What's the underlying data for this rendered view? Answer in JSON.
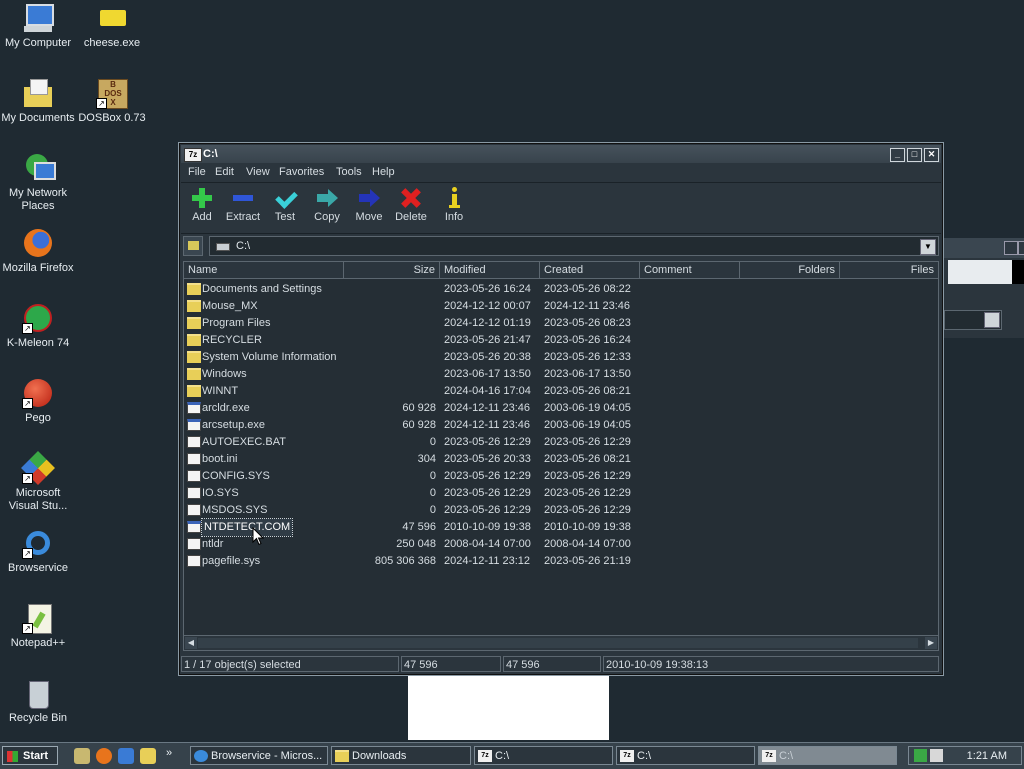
{
  "desktop": {
    "icons": [
      {
        "label": "My Computer"
      },
      {
        "label": "cheese.exe"
      },
      {
        "label": "My Documents"
      },
      {
        "label": "DOSBox 0.73",
        "badge": "B\nDOS"
      },
      {
        "label": "My Network Places"
      },
      {
        "label": "Mozilla Firefox"
      },
      {
        "label": "K-Meleon 74"
      },
      {
        "label": "Pego"
      },
      {
        "label": "Microsoft Visual Stu..."
      },
      {
        "label": "Browservice"
      },
      {
        "label": "Notepad++"
      },
      {
        "label": "Recycle Bin"
      }
    ]
  },
  "window": {
    "icon_text": "7z",
    "title": "C:\\",
    "controls": {
      "minimize": "_",
      "maximize": "□",
      "close": "✕"
    },
    "menu": [
      "File",
      "Edit",
      "View",
      "Favorites",
      "Tools",
      "Help"
    ],
    "toolbar": [
      {
        "label": "Add",
        "icon": "plus-icon",
        "color": "#34c84a"
      },
      {
        "label": "Extract",
        "icon": "minus-icon",
        "color": "#2f56d8"
      },
      {
        "label": "Test",
        "icon": "check-icon",
        "color": "#3ad0d8"
      },
      {
        "label": "Copy",
        "icon": "copy-arrow-icon",
        "color": "#3aa8a8"
      },
      {
        "label": "Move",
        "icon": "move-arrow-icon",
        "color": "#2434b8"
      },
      {
        "label": "Delete",
        "icon": "delete-x-icon",
        "color": "#e02020"
      },
      {
        "label": "Info",
        "icon": "info-icon",
        "color": "#e8d020"
      }
    ],
    "address": {
      "path": "C:\\",
      "dropdown": "▼"
    },
    "columns": [
      "Name",
      "Size",
      "Modified",
      "Created",
      "Comment",
      "Folders",
      "Files"
    ],
    "files": [
      {
        "name": "Documents and Settings",
        "size": "",
        "modified": "2023-05-26 16:24",
        "created": "2023-05-26 08:22",
        "kind": "folder"
      },
      {
        "name": "Mouse_MX",
        "size": "",
        "modified": "2024-12-12 00:07",
        "created": "2024-12-11 23:46",
        "kind": "folder"
      },
      {
        "name": "Program Files",
        "size": "",
        "modified": "2024-12-12 01:19",
        "created": "2023-05-26 08:23",
        "kind": "folder"
      },
      {
        "name": "RECYCLER",
        "size": "",
        "modified": "2023-05-26 21:47",
        "created": "2023-05-26 16:24",
        "kind": "folder"
      },
      {
        "name": "System Volume Information",
        "size": "",
        "modified": "2023-05-26 20:38",
        "created": "2023-05-26 12:33",
        "kind": "folder"
      },
      {
        "name": "Windows",
        "size": "",
        "modified": "2023-06-17 13:50",
        "created": "2023-06-17 13:50",
        "kind": "folder"
      },
      {
        "name": "WINNT",
        "size": "",
        "modified": "2024-04-16 17:04",
        "created": "2023-05-26 08:21",
        "kind": "folder"
      },
      {
        "name": "arcldr.exe",
        "size": "60 928",
        "modified": "2024-12-11 23:46",
        "created": "2003-06-19 04:05",
        "kind": "exe"
      },
      {
        "name": "arcsetup.exe",
        "size": "60 928",
        "modified": "2024-12-11 23:46",
        "created": "2003-06-19 04:05",
        "kind": "exe"
      },
      {
        "name": "AUTOEXEC.BAT",
        "size": "0",
        "modified": "2023-05-26 12:29",
        "created": "2023-05-26 12:29",
        "kind": "bat"
      },
      {
        "name": "boot.ini",
        "size": "304",
        "modified": "2023-05-26 20:33",
        "created": "2023-05-26 08:21",
        "kind": "file"
      },
      {
        "name": "CONFIG.SYS",
        "size": "0",
        "modified": "2023-05-26 12:29",
        "created": "2023-05-26 12:29",
        "kind": "file"
      },
      {
        "name": "IO.SYS",
        "size": "0",
        "modified": "2023-05-26 12:29",
        "created": "2023-05-26 12:29",
        "kind": "file"
      },
      {
        "name": "MSDOS.SYS",
        "size": "0",
        "modified": "2023-05-26 12:29",
        "created": "2023-05-26 12:29",
        "kind": "file"
      },
      {
        "name": "NTDETECT.COM",
        "size": "47 596",
        "modified": "2010-10-09 19:38",
        "created": "2010-10-09 19:38",
        "kind": "exe",
        "selected": true
      },
      {
        "name": "ntldr",
        "size": "250 048",
        "modified": "2008-04-14 07:00",
        "created": "2008-04-14 07:00",
        "kind": "file"
      },
      {
        "name": "pagefile.sys",
        "size": "805 306 368",
        "modified": "2024-12-11 23:12",
        "created": "2023-05-26 21:19",
        "kind": "file"
      }
    ],
    "status": {
      "selection": "1 / 17 object(s) selected",
      "size": "47 596",
      "packed": "47 596",
      "modified": "2010-10-09 19:38:13"
    },
    "scroll_left": "◀",
    "scroll_right": "▶"
  },
  "taskbar": {
    "start_label": "Start",
    "quick_launch": [
      "show-desktop-icon",
      "firefox-icon",
      "network-icon",
      "search-icon"
    ],
    "more": "»",
    "tasks": [
      {
        "label": "Browservice - Micros...",
        "active": false
      },
      {
        "label": "Downloads",
        "active": false
      },
      {
        "label": "C:\\",
        "active": false
      },
      {
        "label": "C:\\",
        "active": false
      },
      {
        "label": "C:\\",
        "active": true
      }
    ],
    "clock": "1:21 AM"
  }
}
